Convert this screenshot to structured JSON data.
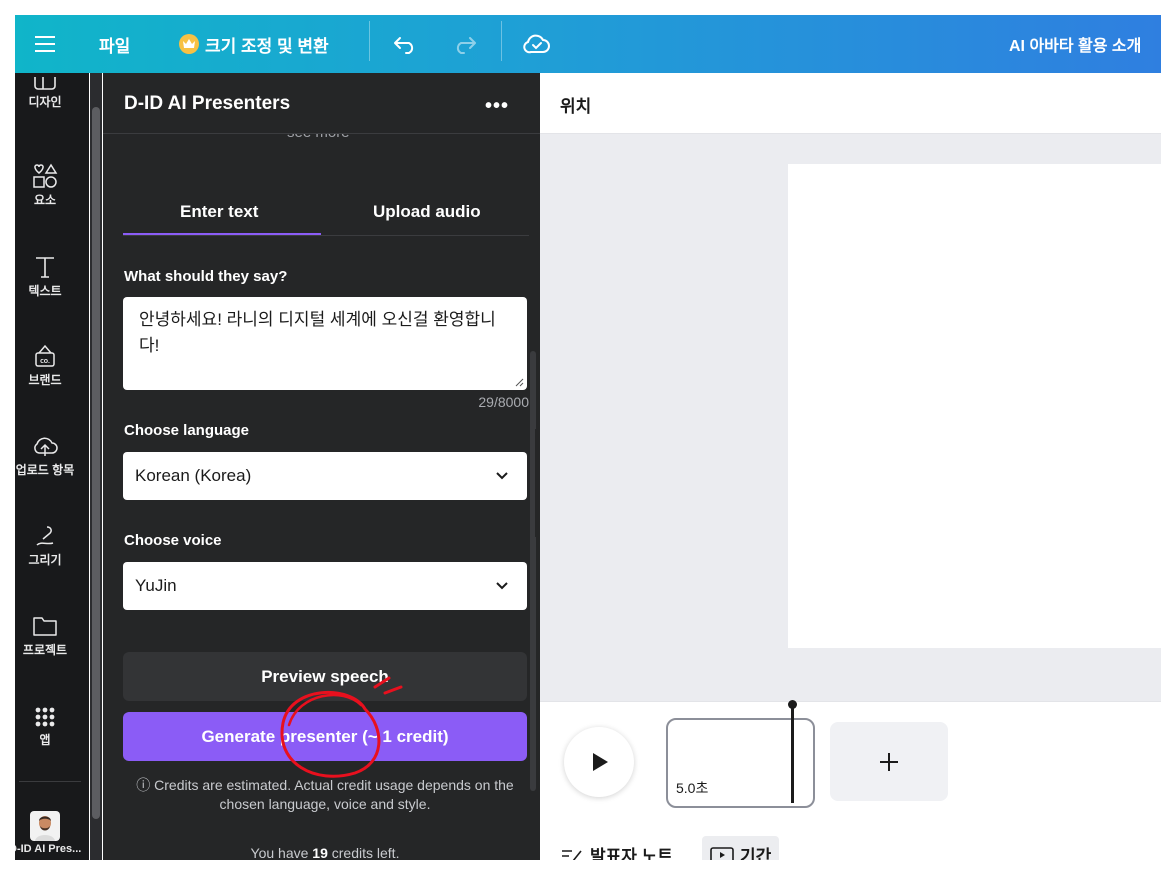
{
  "topbar": {
    "menu_icon": "hamburger-icon",
    "file_label": "파일",
    "resize_label": "크기 조정 및 변환",
    "resize_icon": "crown-icon",
    "undo_icon": "undo-icon",
    "redo_icon": "redo-icon",
    "save_icon": "cloud-check-icon",
    "doc_title": "AI 아바타 활용 소개"
  },
  "rail": {
    "items": [
      {
        "label": "디자인",
        "icon": "design-icon"
      },
      {
        "label": "요소",
        "icon": "elements-icon"
      },
      {
        "label": "텍스트",
        "icon": "text-icon"
      },
      {
        "label": "브랜드",
        "icon": "brand-icon"
      },
      {
        "label": "업로드 항목",
        "icon": "upload-icon"
      },
      {
        "label": "그리기",
        "icon": "draw-icon"
      },
      {
        "label": "프로젝트",
        "icon": "folder-icon"
      },
      {
        "label": "앱",
        "icon": "apps-icon"
      },
      {
        "label": "D-ID AI Pres...",
        "icon": "avatar-app-icon"
      }
    ]
  },
  "panel": {
    "title": "D-ID AI Presenters",
    "more_icon": "more-dots-icon",
    "see_more": "see more",
    "tabs": [
      {
        "label": "Enter text",
        "active": true
      },
      {
        "label": "Upload audio",
        "active": false
      }
    ],
    "script_label": "What should they say?",
    "script_text": "안녕하세요! 라니의 디지털 세계에 오신걸 환영합니다!",
    "char_count": "29/8000",
    "language_label": "Choose language",
    "language_value": "Korean (Korea)",
    "voice_label": "Choose voice",
    "voice_value": "YuJin",
    "preview_button": "Preview speech",
    "generate_button": "Generate presenter (~ 1 credit)",
    "info_icon": "info-icon",
    "credit_note": "Credits are estimated. Actual credit usage depends on the chosen language, voice and style.",
    "credits_prefix": "You have ",
    "credits_count": "19",
    "credits_suffix": " credits left."
  },
  "editor": {
    "position_label": "위치",
    "clip_duration": "5.0초",
    "play_icon": "play-icon",
    "add_page_icon": "plus-icon",
    "notes_label": "발표자 노트",
    "duration_label": "기간"
  },
  "colors": {
    "accent": "#8b5cf6",
    "topbar_start": "#10b5c9",
    "topbar_end": "#2f7fe0",
    "panel_bg": "#252627",
    "rail_bg": "#18191b",
    "annotation": "#e8101e"
  }
}
